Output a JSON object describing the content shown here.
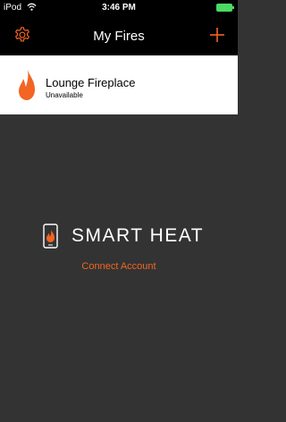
{
  "status_bar": {
    "carrier": "iPod",
    "time": "3:46 PM"
  },
  "nav_bar": {
    "title": "My Fires"
  },
  "fires": [
    {
      "name": "Lounge Fireplace",
      "status": "Unavailable"
    }
  ],
  "brand": {
    "name": "SMART HEAT",
    "connect_label": "Connect Account"
  },
  "colors": {
    "accent": "#f26522",
    "background": "#333333",
    "bar": "#000000",
    "battery": "#4cd964"
  },
  "icons": {
    "settings": "gear-icon",
    "add": "plus-icon",
    "fire": "flame-icon",
    "brand": "phone-flame-icon",
    "wifi": "wifi-icon",
    "battery": "battery-icon"
  }
}
